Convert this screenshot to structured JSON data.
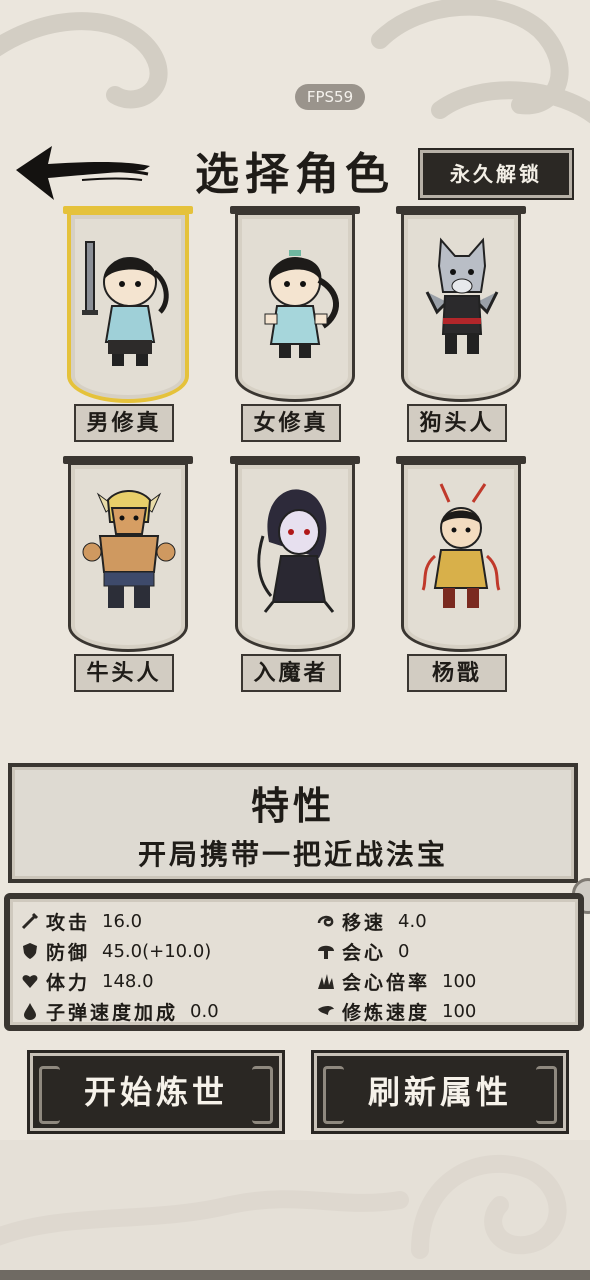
{
  "hud": {
    "fps": "FPS59"
  },
  "header": {
    "title": "选择角色",
    "unlock_label": "永久解锁"
  },
  "characters": [
    {
      "name": "男修真",
      "selected": true
    },
    {
      "name": "女修真",
      "selected": false
    },
    {
      "name": "狗头人",
      "selected": false
    },
    {
      "name": "牛头人",
      "selected": false
    },
    {
      "name": "入魔者",
      "selected": false
    },
    {
      "name": "杨戬",
      "selected": false
    }
  ],
  "trait": {
    "title": "特性",
    "description": "开局携带一把近战法宝"
  },
  "stats": [
    {
      "label": "攻击",
      "value": "16.0",
      "icon": "sword-icon"
    },
    {
      "label": "防御",
      "value": "45.0(+10.0)",
      "icon": "shield-icon"
    },
    {
      "label": "体力",
      "value": "148.0",
      "icon": "heart-icon"
    },
    {
      "label": "子弹速度加成",
      "value": "0.0",
      "icon": "drop-icon"
    },
    {
      "label": "移速",
      "value": "4.0",
      "icon": "swirl-icon"
    },
    {
      "label": "会心",
      "value": "0",
      "icon": "mushroom-icon"
    },
    {
      "label": "会心倍率",
      "value": "100",
      "icon": "grass-icon"
    },
    {
      "label": "修炼速度",
      "value": "100",
      "icon": "wing-icon"
    }
  ],
  "buttons": {
    "start": "开始炼世",
    "refresh": "刷新属性"
  },
  "colors": {
    "selected_frame": "#e5c23b",
    "ink": "#2a2723",
    "paper": "#ebe6dd"
  }
}
